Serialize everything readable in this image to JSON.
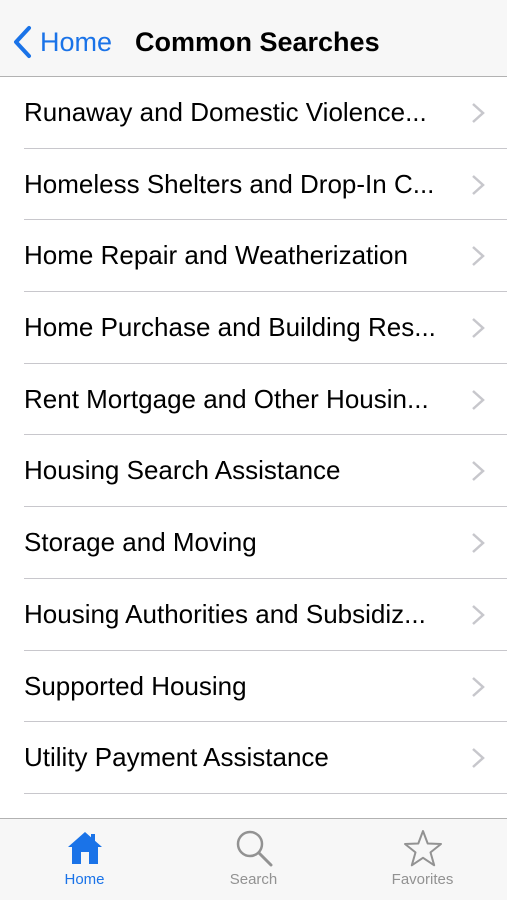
{
  "navbar": {
    "back_label": "Home",
    "title": "Common Searches"
  },
  "list": {
    "items": [
      {
        "label": "Runaway and Domestic Violence..."
      },
      {
        "label": "Homeless Shelters and Drop-In C..."
      },
      {
        "label": "Home Repair and Weatherization"
      },
      {
        "label": "Home Purchase and Building Res..."
      },
      {
        "label": "Rent Mortgage and Other Housin..."
      },
      {
        "label": "Housing Search Assistance"
      },
      {
        "label": "Storage and Moving"
      },
      {
        "label": "Housing Authorities and Subsidiz..."
      },
      {
        "label": "Supported Housing"
      },
      {
        "label": "Utility Payment Assistance"
      }
    ]
  },
  "tabbar": {
    "tabs": [
      {
        "label": "Home",
        "icon": "home-icon",
        "active": true
      },
      {
        "label": "Search",
        "icon": "search-icon",
        "active": false
      },
      {
        "label": "Favorites",
        "icon": "star-icon",
        "active": false
      }
    ]
  },
  "colors": {
    "accent": "#1a73e8",
    "inactive": "#929292",
    "separator": "#c8c7cc",
    "bar_background": "#f7f7f7"
  }
}
